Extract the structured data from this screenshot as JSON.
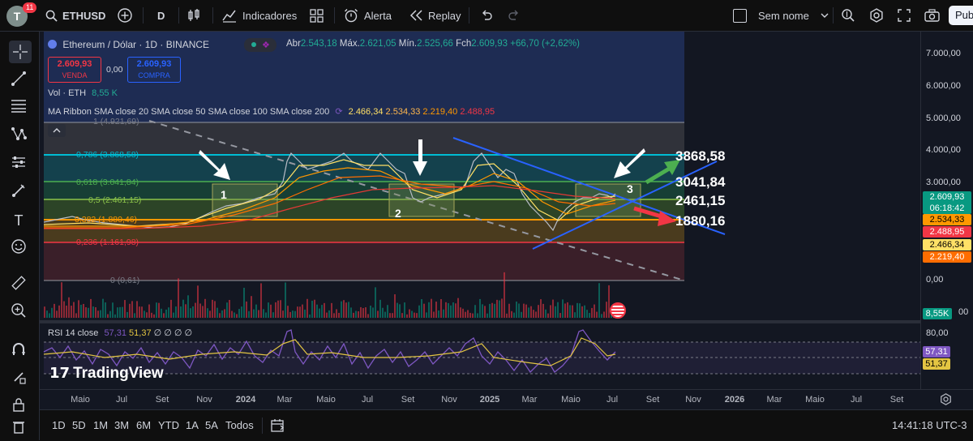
{
  "topbar": {
    "avatar_letter": "T",
    "notification_count": "11",
    "symbol": "ETHUSD",
    "interval": "D",
    "indicators_label": "Indicadores",
    "alert_label": "Alerta",
    "replay_label": "Replay",
    "layout_name": "Sem nome",
    "publish_label": "Pub"
  },
  "legend": {
    "title": "Ethereum / Dólar · 1D · BINANCE",
    "open_label": "Abr",
    "open": "2.543,18",
    "high_label": "Máx.",
    "high": "2.621,05",
    "low_label": "Mín.",
    "low": "2.525,66",
    "close_label": "Fch",
    "close": "2.609,93",
    "change": "+66,70 (+2,62%)",
    "sell_price": "2.609,93",
    "sell_label": "VENDA",
    "spread": "0,00",
    "buy_price": "2.609,93",
    "buy_label": "COMPRA",
    "volume_label": "Vol · ETH",
    "volume_value": "8,55 K",
    "ribbon_label": "MA Ribbon SMA close 20 SMA close 50 SMA close 100 SMA close 200",
    "ribbon_v1": "2.466,34",
    "ribbon_v2": "2.534,33",
    "ribbon_v3": "2.219,40",
    "ribbon_v4": "2.488,95"
  },
  "fib_levels": [
    {
      "label": "1 (4.921,69)",
      "color": "#787b86"
    },
    {
      "label": "0,786 (3.868,58)",
      "color": "#00bcd4"
    },
    {
      "label": "0,618 (3.041,84)",
      "color": "#4caf50"
    },
    {
      "label": "0,5 (2.461,15)",
      "color": "#8bc34a"
    },
    {
      "label": "0,382 (1.880,46)",
      "color": "#ff9800"
    },
    {
      "label": "0,236 (1.161,98)",
      "color": "#f23645"
    },
    {
      "label": "0 (0,61)",
      "color": "#787b86"
    }
  ],
  "annotations": {
    "box1": "1",
    "box2": "2",
    "box3": "3",
    "target_top": "3868,58",
    "level_a": "3041,84",
    "level_b": "2461,15",
    "target_bottom": "1880,16"
  },
  "price_scale": {
    "labels": [
      "7.000,00",
      "6.000,00",
      "5.000,00",
      "4.000,00",
      "3.000,00",
      "0,00"
    ],
    "current_price": "2.609,93",
    "countdown": "06:18:42",
    "ma_tags": [
      "2.534,33",
      "2.488,95",
      "2.466,34",
      "2.219,40"
    ],
    "volume_tag": "8,55K",
    "volume_tail": "00",
    "rsi_labels": [
      "80,00"
    ],
    "rsi_tags": [
      "57,31",
      "51,37"
    ]
  },
  "rsi": {
    "label": "RSI 14 close",
    "value1": "57,31",
    "value2": "51,37",
    "extra": "∅ ∅ ∅ ∅"
  },
  "watermark": "TradingView",
  "time_axis": [
    "Maio",
    "Jul",
    "Set",
    "Nov",
    "2024",
    "Mar",
    "Maio",
    "Jul",
    "Set",
    "Nov",
    "2025",
    "Mar",
    "Maio",
    "Jul",
    "Set",
    "Nov",
    "2026",
    "Mar",
    "Maio",
    "Jul",
    "Set"
  ],
  "bottombar": {
    "ranges": [
      "1D",
      "5D",
      "1M",
      "3M",
      "6M",
      "YTD",
      "1A",
      "5A",
      "Todos"
    ],
    "clock": "14:41:18 UTC-3"
  },
  "colors": {
    "background": "#131722",
    "accent": "#2962ff",
    "up": "#089981",
    "down": "#f23645"
  }
}
